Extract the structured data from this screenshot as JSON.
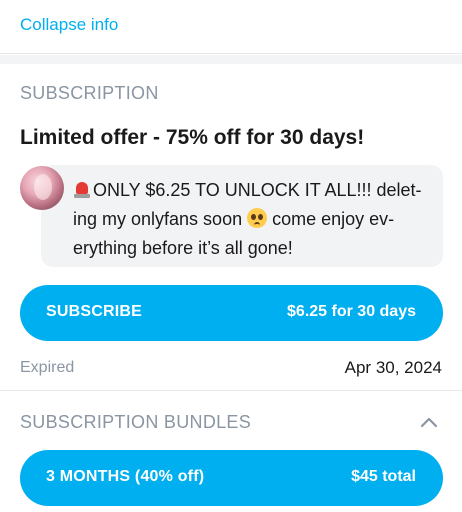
{
  "header": {
    "collapse_label": "Collapse info"
  },
  "subscription": {
    "section_title": "SUBSCRIPTION",
    "offer_title": "Limited offer - 75% off for 30 days!",
    "message": {
      "leading_icon": "police-car-light-emoji",
      "text_part1": "ONLY $6.25 TO UNLOCK IT ALL!!! delet-ing my onlyfans soon ",
      "inline_icon": "pleading-face-emoji",
      "text_part2": " come enjoy ev-erything before it’s all gone!"
    },
    "subscribe_button": {
      "label": "SUBSCRIBE",
      "price": "$6.25 for 30 days"
    },
    "expired_label": "Expired",
    "expired_date": "Apr 30, 2024"
  },
  "bundles": {
    "section_title": "SUBSCRIPTION BUNDLES",
    "toggle_icon": "chevron-up-icon",
    "items": [
      {
        "label": "3 MONTHS (40% off)",
        "price": "$45 total"
      }
    ]
  },
  "colors": {
    "accent": "#00aff0",
    "muted_text": "#8a96a3",
    "bubble_bg": "#f2f3f5",
    "divider": "#e6e8ea"
  }
}
